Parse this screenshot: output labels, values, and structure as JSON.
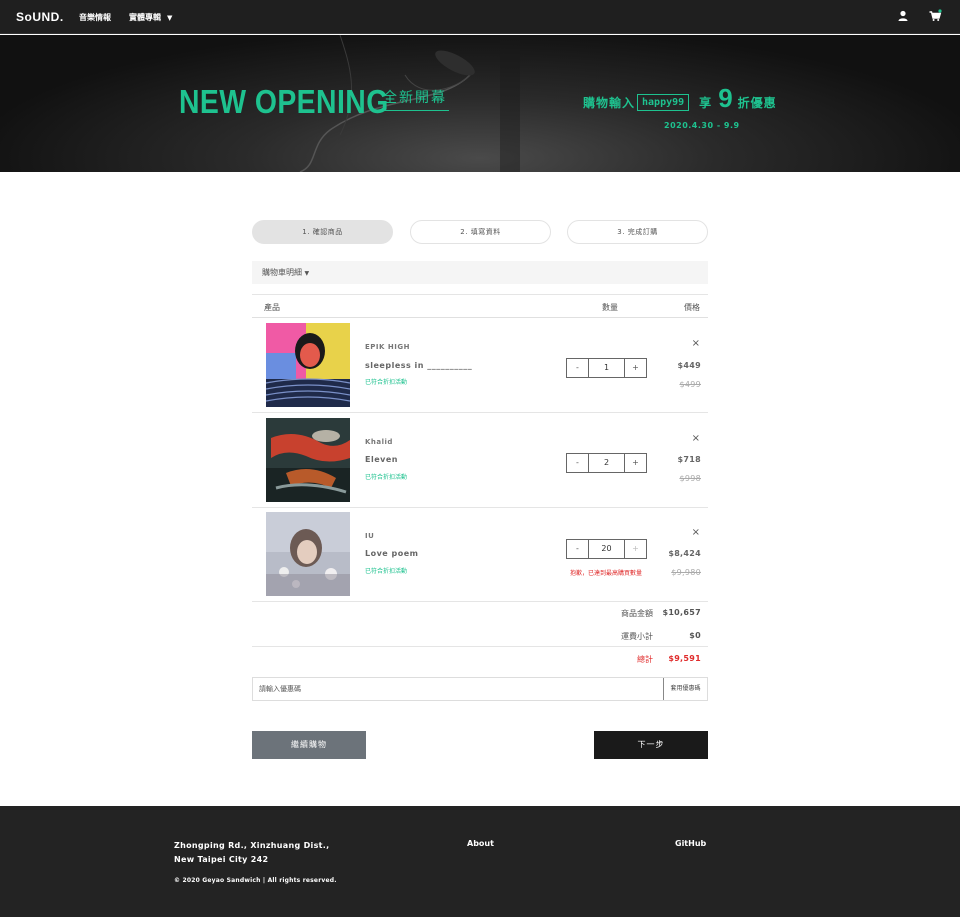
{
  "nav": {
    "logo": "SoUND.",
    "links": [
      {
        "label": "音樂情報"
      },
      {
        "label": "實體專輯"
      }
    ],
    "dropdown_icon": "chevron-down-icon",
    "icons": [
      "user-icon",
      "cart-icon"
    ]
  },
  "banner": {
    "headline": "NEW OPENING",
    "sub_headline": "全新開幕",
    "promo_prefix": "購物輸入",
    "promo_code": "happy99",
    "promo_mid": "享",
    "promo_number": "9",
    "promo_suffix": "折優惠",
    "dates": "2020.4.30 - 9.9",
    "accent_color": "#1ec28f"
  },
  "steps": [
    {
      "label": "1. 確認商品",
      "active": true
    },
    {
      "label": "2. 填寫資料",
      "active": false
    },
    {
      "label": "3. 完成訂購",
      "active": false
    }
  ],
  "cart": {
    "toggle_label": "購物車明細",
    "headers": {
      "product": "產品",
      "quantity": "數量",
      "price": "價格"
    },
    "items": [
      {
        "artist": "EPIK HIGH",
        "album": "sleepless in __________",
        "note": "已符合折扣活動",
        "quantity": "1",
        "price": "$449",
        "original_price": "$499",
        "warning": ""
      },
      {
        "artist": "Khalid",
        "album": "Eleven",
        "note": "已符合折扣活動",
        "quantity": "2",
        "price": "$718",
        "original_price": "$998",
        "warning": ""
      },
      {
        "artist": "IU",
        "album": "Love poem",
        "note": "已符合折扣活動",
        "quantity": "20",
        "price": "$8,424",
        "original_price": "$9,980",
        "warning": "抱歉，已達到最高購買數量"
      }
    ],
    "minus_label": "-",
    "plus_label": "+",
    "remove_symbol": "×",
    "summary": {
      "subtotal_label": "商品金額",
      "subtotal": "$10,657",
      "shipping_label": "運費小計",
      "shipping": "$0",
      "total_label": "總計",
      "total": "$9,591"
    },
    "coupon": {
      "placeholder": "請輸入優惠碼",
      "button_label": "套用優惠碼"
    },
    "continue_label": "繼續購物",
    "next_label": "下一步"
  },
  "footer": {
    "address_line1": "Zhongping Rd., Xinzhuang Dist.,",
    "address_line2": "New Taipei City 242",
    "copyright": "© 2020 Geyao Sandwich | All rights reserved.",
    "about": "About",
    "github": "GitHub"
  }
}
